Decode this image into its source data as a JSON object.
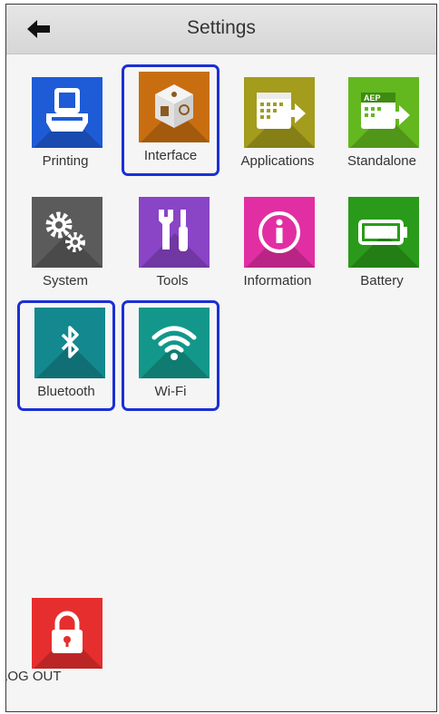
{
  "header": {
    "title": "Settings"
  },
  "tiles": [
    {
      "label": "Printing",
      "color": "#1e5bd6",
      "icon": "printer-icon"
    },
    {
      "label": "Interface",
      "color": "#c86e10",
      "icon": "interface-cube-icon"
    },
    {
      "label": "Applications",
      "color": "#a39c1c",
      "icon": "applications-icon"
    },
    {
      "label": "Standalone",
      "color": "#62b81e",
      "icon": "standalone-aep-icon"
    },
    {
      "label": "System",
      "color": "#5b5b5b",
      "icon": "gears-icon"
    },
    {
      "label": "Tools",
      "color": "#8a44c6",
      "icon": "tools-icon"
    },
    {
      "label": "Information",
      "color": "#e22ea3",
      "icon": "info-icon"
    },
    {
      "label": "Battery",
      "color": "#2a9a1a",
      "icon": "battery-icon"
    },
    {
      "label": "Bluetooth",
      "color": "#13888f",
      "icon": "bluetooth-icon"
    },
    {
      "label": "Wi-Fi",
      "color": "#13978a",
      "icon": "wifi-icon"
    }
  ],
  "logout": {
    "label": "LOG OUT",
    "color": "#e62e2e",
    "icon": "padlock-icon"
  },
  "highlight_color": "#1b2fd6"
}
